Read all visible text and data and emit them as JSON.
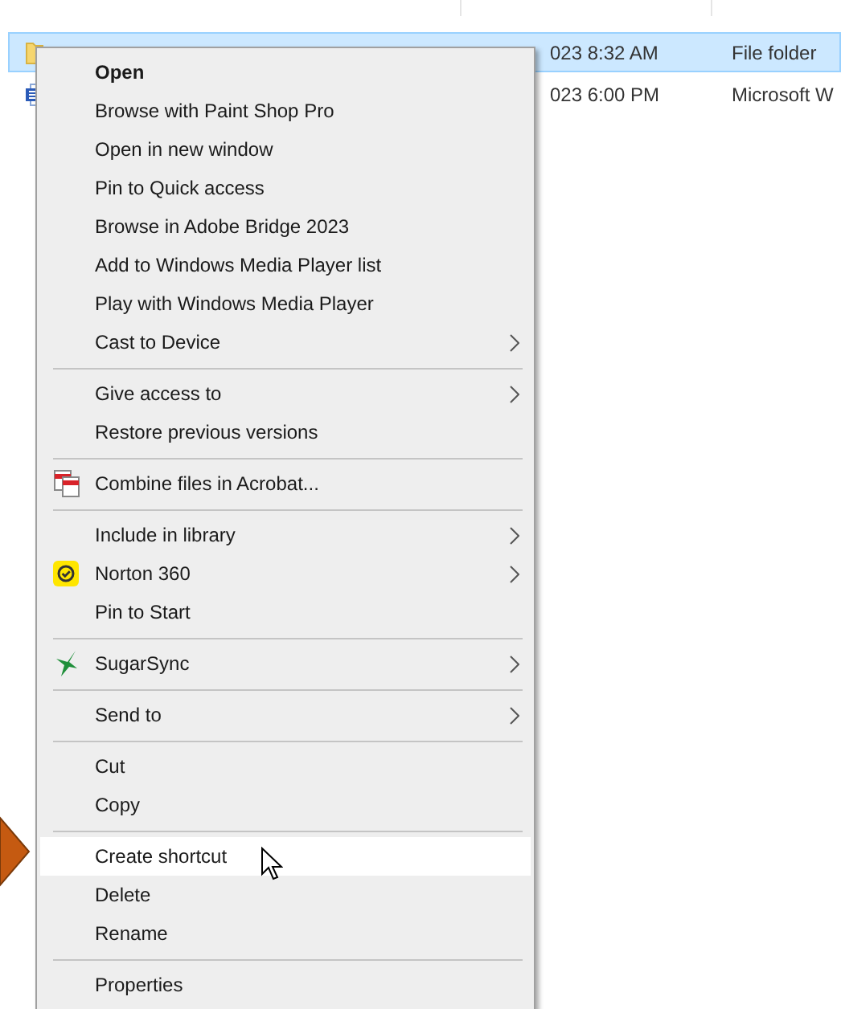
{
  "file_list": {
    "rows": [
      {
        "kind": "folder",
        "date": "023 8:32 AM",
        "type": "File folder",
        "selected": true
      },
      {
        "kind": "document",
        "date": "023 6:00 PM",
        "type": "Microsoft W",
        "selected": false
      }
    ]
  },
  "menu": {
    "groups": [
      {
        "items": [
          {
            "label": "Open",
            "default": true,
            "submenu": false,
            "hovered": false
          },
          {
            "label": "Browse with Paint Shop Pro",
            "default": false,
            "submenu": false,
            "hovered": false
          },
          {
            "label": "Open in new window",
            "default": false,
            "submenu": false,
            "hovered": false
          },
          {
            "label": "Pin to Quick access",
            "default": false,
            "submenu": false,
            "hovered": false
          },
          {
            "label": "Browse in Adobe Bridge 2023",
            "default": false,
            "submenu": false,
            "hovered": false
          },
          {
            "label": "Add to Windows Media Player list",
            "default": false,
            "submenu": false,
            "hovered": false
          },
          {
            "label": "Play with Windows Media Player",
            "default": false,
            "submenu": false,
            "hovered": false
          },
          {
            "label": "Cast to Device",
            "default": false,
            "submenu": true,
            "hovered": false
          }
        ]
      },
      {
        "items": [
          {
            "label": "Give access to",
            "default": false,
            "submenu": true,
            "hovered": false
          },
          {
            "label": "Restore previous versions",
            "default": false,
            "submenu": false,
            "hovered": false
          }
        ]
      },
      {
        "items": [
          {
            "label": "Combine files in Acrobat...",
            "kind": "stacked",
            "default": false,
            "submenu": false,
            "hovered": false
          }
        ]
      },
      {
        "items": [
          {
            "label": "Include in library",
            "default": false,
            "submenu": true,
            "hovered": false
          },
          {
            "label": "Norton 360",
            "kind": "badge",
            "default": false,
            "submenu": true,
            "hovered": false
          },
          {
            "label": "Pin to Start",
            "default": false,
            "submenu": false,
            "hovered": false
          }
        ]
      },
      {
        "items": [
          {
            "label": "SugarSync",
            "kind": "bird",
            "default": false,
            "submenu": true,
            "hovered": false
          }
        ]
      },
      {
        "items": [
          {
            "label": "Send to",
            "default": false,
            "submenu": true,
            "hovered": false
          }
        ]
      },
      {
        "items": [
          {
            "label": "Cut",
            "default": false,
            "submenu": false,
            "hovered": false
          },
          {
            "label": "Copy",
            "default": false,
            "submenu": false,
            "hovered": false
          }
        ]
      },
      {
        "items": [
          {
            "label": "Create shortcut",
            "default": false,
            "submenu": false,
            "hovered": true
          },
          {
            "label": "Delete",
            "default": false,
            "submenu": false,
            "hovered": false
          },
          {
            "label": "Rename",
            "default": false,
            "submenu": false,
            "hovered": false
          }
        ]
      },
      {
        "items": [
          {
            "label": "Properties",
            "default": false,
            "submenu": false,
            "hovered": false
          }
        ]
      }
    ]
  }
}
